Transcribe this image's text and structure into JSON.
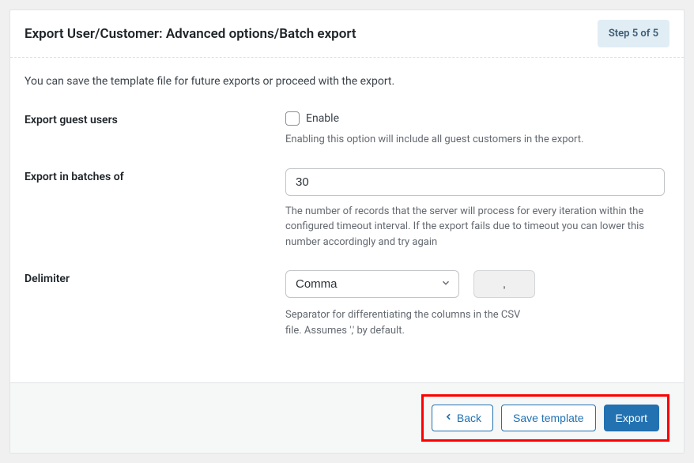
{
  "header": {
    "title": "Export User/Customer: Advanced options/Batch export",
    "step_badge": "Step 5 of 5"
  },
  "intro": "You can save the template file for future exports or proceed with the export.",
  "form": {
    "guest_users": {
      "label": "Export guest users",
      "checkbox_label": "Enable",
      "help": "Enabling this option will include all guest customers in the export."
    },
    "batch": {
      "label": "Export in batches of",
      "value": "30",
      "help": "The number of records that the server will process for every iteration within the configured timeout interval. If the export fails due to timeout you can lower this number accordingly and try again"
    },
    "delimiter": {
      "label": "Delimiter",
      "selected": "Comma",
      "preview": ",",
      "help": "Separator for differentiating the columns in the CSV file. Assumes ',' by default."
    }
  },
  "footer": {
    "back": "Back",
    "save_template": "Save template",
    "export": "Export"
  }
}
